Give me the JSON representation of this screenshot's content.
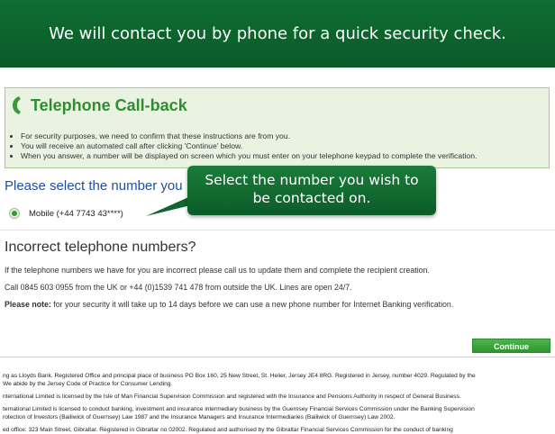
{
  "banner": {
    "text": "We will contact you by phone for a quick security check."
  },
  "callback": {
    "title": "Telephone Call-back",
    "instructions": [
      "For security purposes, we need to confirm that these instructions are from you.",
      "You will receive an automated call after clicking 'Continue' below.",
      "When you answer, a number will be displayed on screen which you must enter on your telephone keypad to complete the verification."
    ]
  },
  "selection": {
    "heading": "Please select the number you",
    "option_label": "Mobile (+44 7743 43****)"
  },
  "tooltip": {
    "line1": "Select the number you wish to",
    "line2": "be contacted on."
  },
  "incorrect": {
    "title": "Incorrect telephone numbers?",
    "line1": "If the telephone numbers we have for you are incorrect please call us to update them and complete the recipient creation.",
    "line2": "Call 0845 603 0955 from the UK or +44 (0)1539 741 478 from outside the UK. Lines are open 24/7.",
    "note_label": "Please note:",
    "note_text": " for your security it will take up to 14 days before we can use a new phone number for Internet Banking verification."
  },
  "actions": {
    "continue_label": "Continue"
  },
  "legal": [
    "ng as Lloyds Bank. Registered Office and principal place of business PO Box 160, 25 New Street, St. Helier, Jersey JE4 8RG. Registered in Jersey, number 4029. Regulated by the",
    "We abide by the Jersey Code of Practice for Consumer Lending.",
    "nternational Limited is licensed by the Isle of Man Financial Supervision Commission and registered with the Insurance and Pensions Authority in respect of General Business.",
    "ternational Limited is licensed to conduct banking, investment and insurance intermediary business by the Guernsey Financial Services Commission under the Banking Supervision",
    "rotection of Investors (Bailiwick of Guernsey) Law 1987 and the Insurance Managers and Insurance Intermediaries (Bailiwick of Guernsey) Law 2002.",
    "ed office: 323 Main Street, Gibraltar. Registered in Gibraltar no 02002. Regulated and authorised by the Gibraltar Financial Services Commission for the conduct of banking"
  ],
  "colors": {
    "banner_green": "#0f6e32",
    "title_green": "#2f8f2f",
    "heading_blue": "#1f4fa0",
    "button_green": "#3aa63a"
  }
}
